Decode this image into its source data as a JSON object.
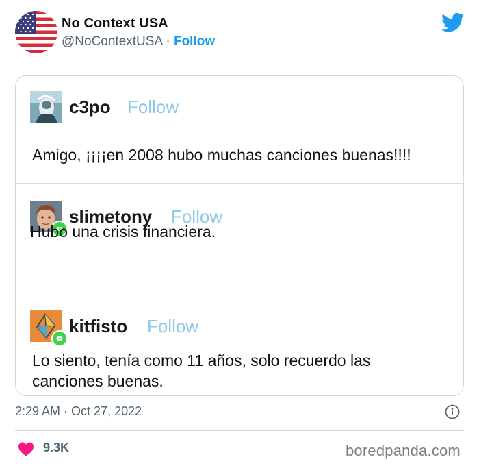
{
  "account": {
    "display_name": "No Context USA",
    "handle": "@NoContextUSA",
    "separator": " · ",
    "follow_label": "Follow",
    "avatar_icon": "us-flag-icon"
  },
  "brand_icon": "twitter-bird-icon",
  "colors": {
    "twitter_blue": "#1d9bf0",
    "tumblr_follow": "#8ec9e8",
    "reblog_green": "#3fd24a",
    "like_pink": "#f91880",
    "muted_text": "#536471"
  },
  "embedded_posts": [
    {
      "username": "c3po",
      "follow_label": "Follow",
      "avatar_icon": "c3po-avatar-icon",
      "reblogged": false,
      "text": "Amigo, ¡¡¡¡en 2008 hubo muchas canciones buenas!!!!"
    },
    {
      "username": "slimetony",
      "follow_label": "Follow",
      "avatar_icon": "slimetony-avatar-icon",
      "reblogged": true,
      "text": "Hubo una crisis financiera."
    },
    {
      "username": "kitfisto",
      "follow_label": "Follow",
      "avatar_icon": "kitfisto-avatar-icon",
      "reblogged": true,
      "text": "Lo siento, tenía como 11 años, solo recuerdo las canciones buenas."
    }
  ],
  "footer": {
    "timestamp": "2:29 AM · Oct 27, 2022",
    "likes": "9.3K",
    "info_icon": "info-icon",
    "heart_icon": "heart-icon"
  },
  "watermark": "boredpanda.com"
}
